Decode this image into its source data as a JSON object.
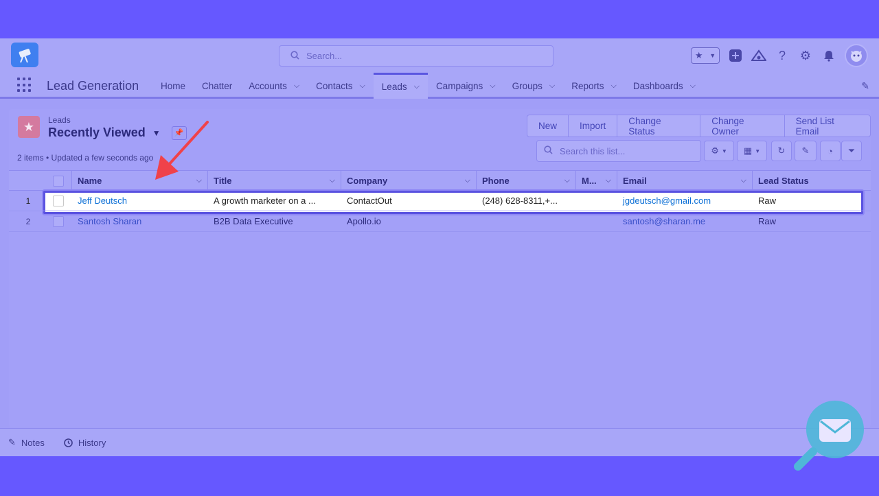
{
  "header": {
    "search_placeholder": "Search...",
    "icons": [
      "favorites-star-icon",
      "add-icon",
      "trailhead-icon",
      "help-icon",
      "setup-gear-icon",
      "notifications-bell-icon",
      "avatar-icon"
    ]
  },
  "nav": {
    "app_name": "Lead Generation",
    "tabs": [
      {
        "label": "Home",
        "dropdown": false
      },
      {
        "label": "Chatter",
        "dropdown": false
      },
      {
        "label": "Accounts",
        "dropdown": true
      },
      {
        "label": "Contacts",
        "dropdown": true
      },
      {
        "label": "Leads",
        "dropdown": true,
        "active": true
      },
      {
        "label": "Campaigns",
        "dropdown": true
      },
      {
        "label": "Groups",
        "dropdown": true
      },
      {
        "label": "Reports",
        "dropdown": true
      },
      {
        "label": "Dashboards",
        "dropdown": true
      }
    ]
  },
  "list": {
    "object_label": "Leads",
    "view_name": "Recently Viewed",
    "meta": "2 items • Updated a few seconds ago",
    "buttons": [
      "New",
      "Import",
      "Change Status",
      "Change Owner",
      "Send List Email"
    ],
    "search_placeholder": "Search this list..."
  },
  "table": {
    "columns": [
      "Name",
      "Title",
      "Company",
      "Phone",
      "M...",
      "Email",
      "Lead Status"
    ],
    "rows": [
      {
        "num": "1",
        "name": "Jeff Deutsch",
        "title": "A growth marketer on a ...",
        "company": "ContactOut",
        "phone": "(248) 628-8311,+...",
        "mobile": "",
        "email": "jgdeutsch@gmail.com",
        "status": "Raw"
      },
      {
        "num": "2",
        "name": "Santosh Sharan",
        "title": "B2B Data Executive",
        "company": "Apollo.io",
        "phone": "",
        "mobile": "",
        "email": "santosh@sharan.me",
        "status": "Raw"
      }
    ]
  },
  "utility": {
    "notes": "Notes",
    "history": "History"
  },
  "colors": {
    "overlay": "#6658ff",
    "highlight_border": "#5a52e0",
    "arrow": "#f0424a",
    "link": "#0b6fd6"
  }
}
